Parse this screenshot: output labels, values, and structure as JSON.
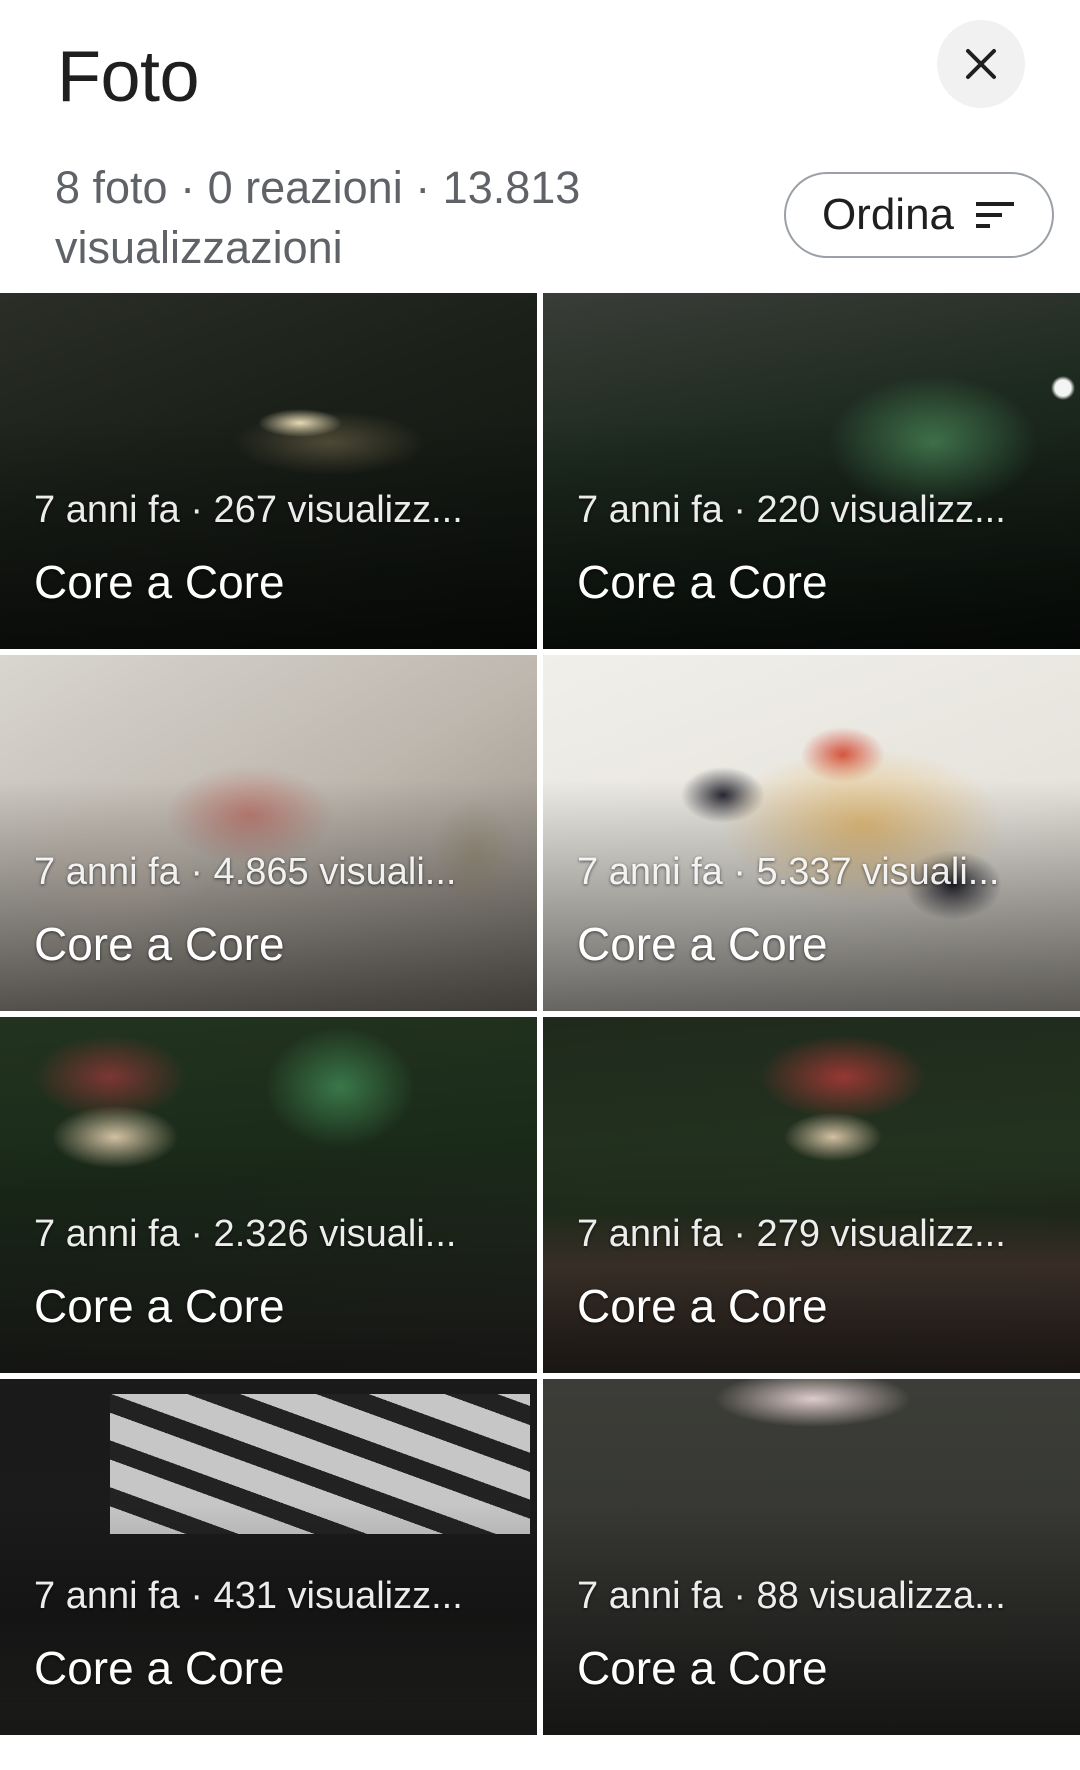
{
  "header": {
    "title": "Foto",
    "close_icon": "close-icon",
    "summary": "8 foto · 0 reazioni · 13.813 visualizzazioni",
    "sort_label": "Ordina",
    "sort_icon": "sort-icon"
  },
  "photos": [
    {
      "meta": "7 anni fa · 267 visualizz...",
      "name": "Core a Core"
    },
    {
      "meta": "7 anni fa · 220 visualizz...",
      "name": "Core a Core"
    },
    {
      "meta": "7 anni fa · 4.865 visuali...",
      "name": "Core a Core"
    },
    {
      "meta": "7 anni fa · 5.337 visuali...",
      "name": "Core a Core"
    },
    {
      "meta": "7 anni fa · 2.326 visuali...",
      "name": "Core a Core"
    },
    {
      "meta": "7 anni fa · 279 visualizz...",
      "name": "Core a Core"
    },
    {
      "meta": "7 anni fa · 431 visualizz...",
      "name": "Core a Core"
    },
    {
      "meta": "7 anni fa · 88 visualizza...",
      "name": "Core a Core"
    }
  ]
}
